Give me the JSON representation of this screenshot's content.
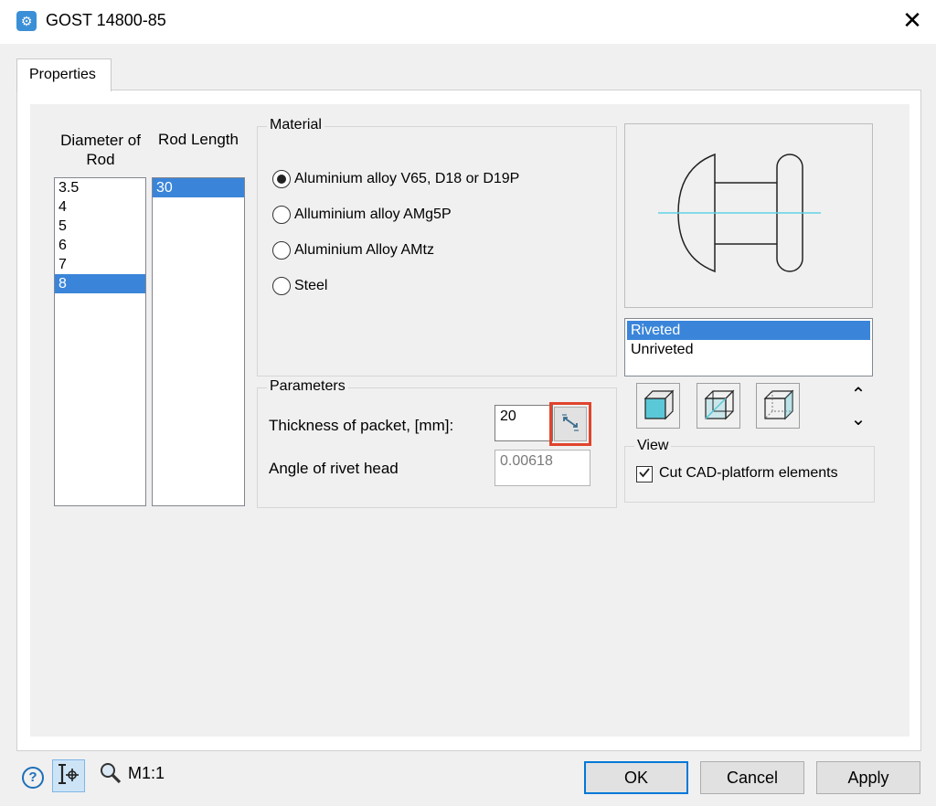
{
  "window": {
    "title": "GOST 14800-85",
    "icon": "gear-icon",
    "close_glyph": "✕"
  },
  "tabs": [
    {
      "label": "Properties",
      "active": true
    }
  ],
  "diameter": {
    "header": "Diameter of Rod",
    "items": [
      "3.5",
      "4",
      "5",
      "6",
      "7",
      "8"
    ],
    "selected": "8"
  },
  "rod_length": {
    "header": "Rod Length",
    "items": [
      "30"
    ],
    "selected": "30"
  },
  "material": {
    "legend": "Material",
    "options": [
      {
        "label": "Aluminium alloy V65, D18 or D19P",
        "checked": true
      },
      {
        "label": "Alluminium alloy AMg5P",
        "checked": false
      },
      {
        "label": "Aluminium Alloy AMtz",
        "checked": false
      },
      {
        "label": "Steel",
        "checked": false
      }
    ]
  },
  "parameters": {
    "legend": "Parameters",
    "thickness_label": "Thickness of packet, [mm]:",
    "thickness_value": "20",
    "measure_icon": "measure-distance-icon",
    "angle_label": "Angle of rivet head",
    "angle_value": "0.00618"
  },
  "rivet_state": {
    "items": [
      "Riveted",
      "Unriveted"
    ],
    "selected": "Riveted"
  },
  "view_modes": {
    "icons": [
      "solid-cube-icon",
      "transparent-cube-icon",
      "wireframe-cube-icon"
    ],
    "scroll_up_glyph": "⌃",
    "scroll_down_glyph": "⌄"
  },
  "view": {
    "legend": "View",
    "cut_label": "Cut CAD-platform elements",
    "cut_checked": true
  },
  "footer": {
    "help_glyph": "?",
    "scale_label": "M1:1",
    "ok": "OK",
    "cancel": "Cancel",
    "apply": "Apply"
  },
  "colors": {
    "selection": "#3a85d9",
    "highlight_border": "#e0442c",
    "preview_centerline": "#5fd3e6",
    "cube_face": "#5bc8d8"
  }
}
